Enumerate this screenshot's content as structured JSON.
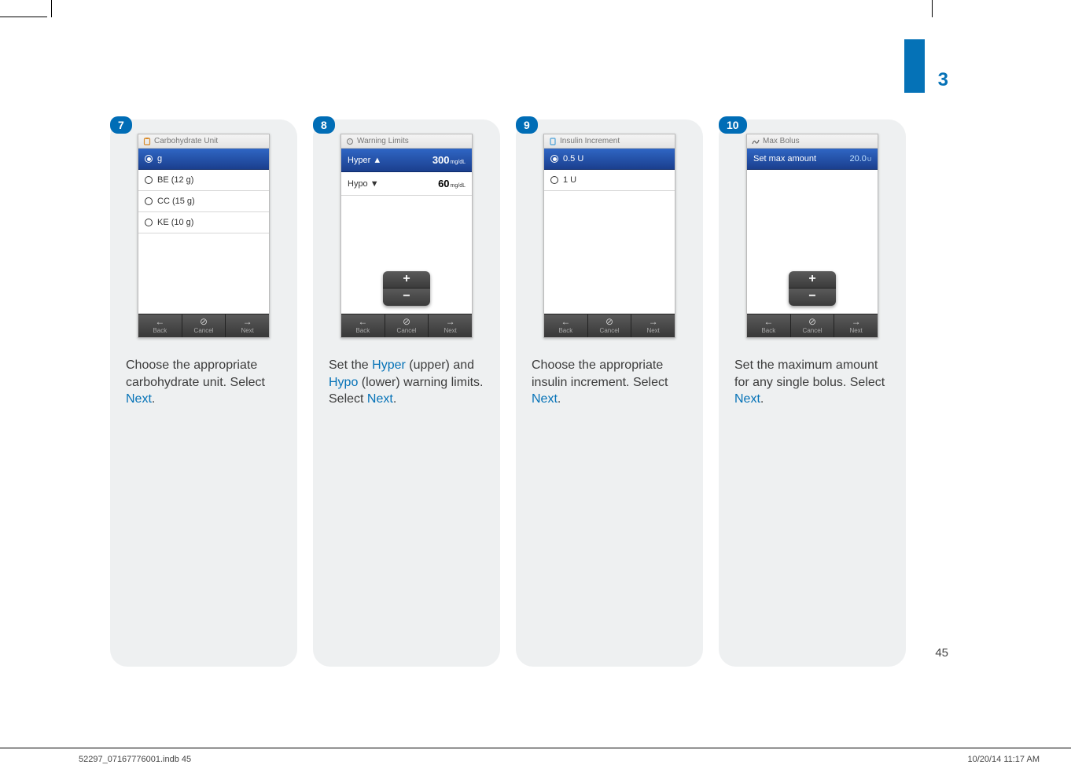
{
  "section_number": "3",
  "page_number": "45",
  "footer_file": "52297_07167776001.indb   45",
  "footer_date": "10/20/14   11:17 AM",
  "toolbar": {
    "back": "Back",
    "cancel": "Cancel",
    "next": "Next"
  },
  "pm": {
    "plus": "+",
    "minus": "−"
  },
  "steps": [
    {
      "num": "7",
      "title": "Carbohydrate Unit",
      "type": "radiolist",
      "options": [
        {
          "label": "g",
          "selected": true
        },
        {
          "label": "BE (12 g)",
          "selected": false
        },
        {
          "label": "CC (15 g)",
          "selected": false
        },
        {
          "label": "KE (10 g)",
          "selected": false
        }
      ],
      "caption_pre": "Choose the appropriate carbohydrate unit. Select ",
      "caption_hl": "Next",
      "caption_post": "."
    },
    {
      "num": "8",
      "title": "Warning Limits",
      "type": "limits",
      "rows": [
        {
          "label": "Hyper ▲",
          "value": "300",
          "unit": "mg/dL",
          "selected": true
        },
        {
          "label": "Hypo ▼",
          "value": "60",
          "unit": "mg/dL",
          "selected": false
        }
      ],
      "caption_parts": [
        "Set the ",
        "Hyper",
        " (upper) and ",
        "Hypo",
        " (lower) warning limits. Select ",
        "Next",
        "."
      ]
    },
    {
      "num": "9",
      "title": "Insulin Increment",
      "type": "radiolist",
      "options": [
        {
          "label": "0.5 U",
          "selected": true
        },
        {
          "label": "1 U",
          "selected": false
        }
      ],
      "caption_pre": "Choose the appropriate insulin increment. Select ",
      "caption_hl": "Next",
      "caption_post": "."
    },
    {
      "num": "10",
      "title": "Max Bolus",
      "type": "value",
      "row": {
        "label": "Set max amount",
        "value": "20.0",
        "unit": "U"
      },
      "caption_pre": "Set the maximum amount for any single bolus. Select ",
      "caption_hl": "Next",
      "caption_post": "."
    }
  ]
}
